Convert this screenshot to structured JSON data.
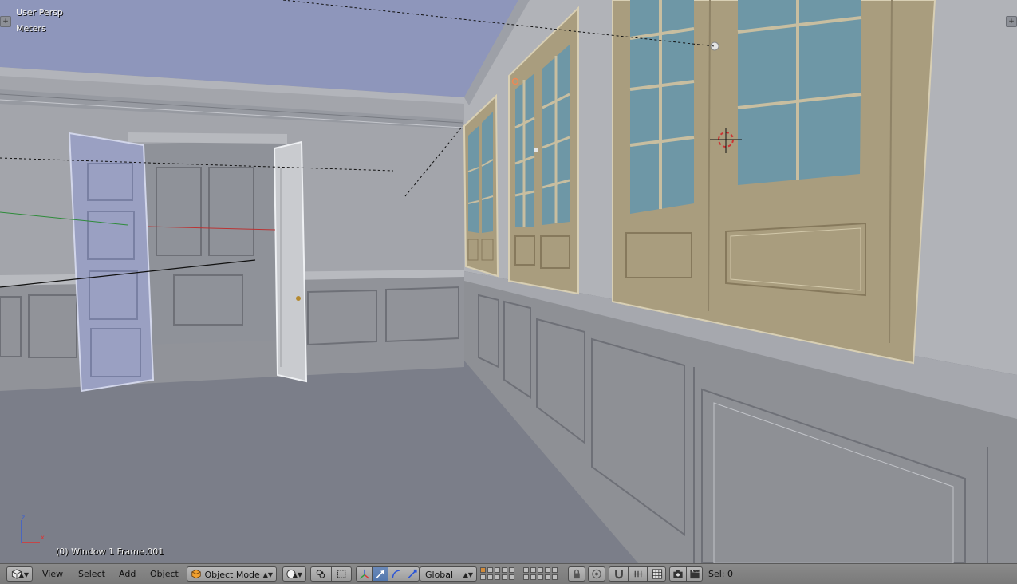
{
  "viewport": {
    "view_name": "User Persp",
    "units": "Meters",
    "object_info": "(0) Window 1 Frame.001",
    "colors": {
      "wall": "#a3a5ab",
      "floor": "#7b7e89",
      "ceiling": "#8e96bb",
      "frame_wood": "#a99d7e",
      "glass": "#6e97a6",
      "door": "#9aa0c2"
    }
  },
  "header": {
    "editor_icon": "3d-view-icon",
    "menus": [
      "View",
      "Select",
      "Add",
      "Object"
    ],
    "mode": "Object Mode",
    "orientation": "Global",
    "selection": "Sel: 0"
  }
}
